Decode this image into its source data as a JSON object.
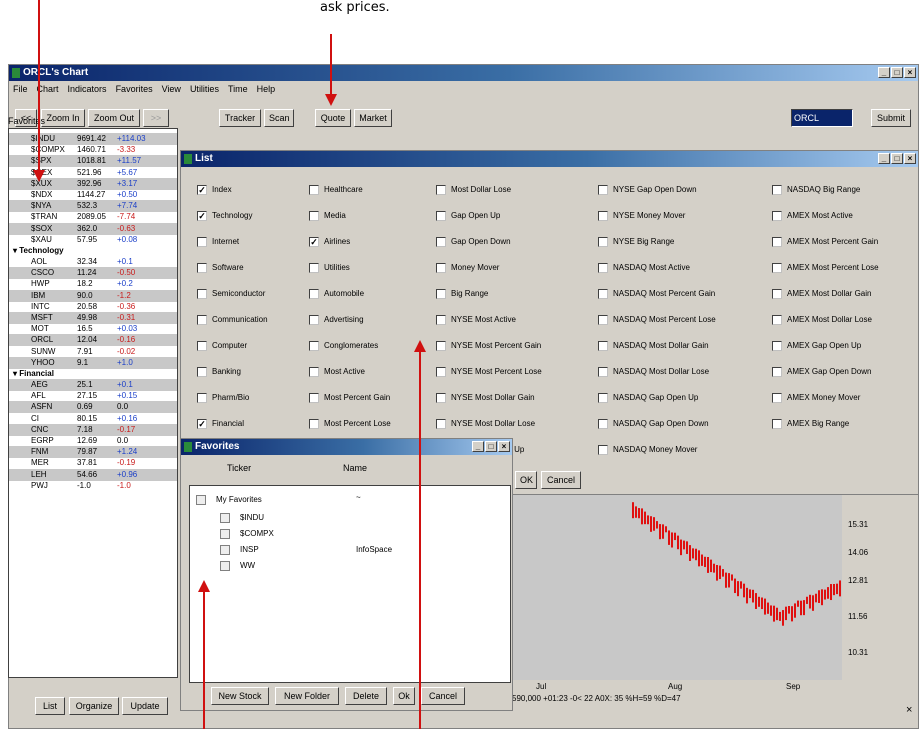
{
  "caption": "ask prices.",
  "main_window": {
    "title": "ORCL's Chart",
    "menu": [
      "File",
      "Chart",
      "Indicators",
      "Favorites",
      "View",
      "Utilities",
      "Time",
      "Help"
    ],
    "toolbar": {
      "back_label": "<<",
      "zoom_in_label": "Zoom In",
      "zoom_out_label": "Zoom Out",
      "forward_label": ">>",
      "tracker_label": "Tracker",
      "scan_label": "Scan",
      "quote_label": "Quote",
      "market_label": "Market",
      "symbol_value": "ORCL",
      "submit_label": "Submit"
    },
    "favorites_label": "Favorites",
    "bottom_buttons": {
      "list": "List",
      "organize": "Organize",
      "update": "Update"
    }
  },
  "favorites_tree": {
    "index_rows": [
      {
        "sym": "$INDU",
        "val": "9691.42",
        "chg": "+114.03",
        "dir": "pos",
        "hl": true
      },
      {
        "sym": "$COMPX",
        "val": "1460.71",
        "chg": "-3.33",
        "dir": "neg",
        "hl": false
      },
      {
        "sym": "$SPX",
        "val": "1018.81",
        "chg": "+11.57",
        "dir": "pos",
        "hl": true
      },
      {
        "sym": "$OEX",
        "val": "521.96",
        "chg": "+5.67",
        "dir": "pos",
        "hl": false
      },
      {
        "sym": "$XUX",
        "val": "392.96",
        "chg": "+3.17",
        "dir": "pos",
        "hl": true
      },
      {
        "sym": "$NDX",
        "val": "1144.27",
        "chg": "+0.50",
        "dir": "pos",
        "hl": false
      },
      {
        "sym": "$NYA",
        "val": "532.3",
        "chg": "+7.74",
        "dir": "pos",
        "hl": true
      },
      {
        "sym": "$TRAN",
        "val": "2089.05",
        "chg": "-7.74",
        "dir": "neg",
        "hl": false
      },
      {
        "sym": "$SOX",
        "val": "362.0",
        "chg": "-0.63",
        "dir": "neg",
        "hl": true
      },
      {
        "sym": "$XAU",
        "val": "57.95",
        "chg": "+0.08",
        "dir": "pos",
        "hl": false
      }
    ],
    "tech_group": "Technology",
    "tech_rows": [
      {
        "sym": "AOL",
        "val": "32.34",
        "chg": "+0.1",
        "dir": "pos",
        "hl": false
      },
      {
        "sym": "CSCO",
        "val": "11.24",
        "chg": "-0.50",
        "dir": "neg",
        "hl": true
      },
      {
        "sym": "HWP",
        "val": "18.2",
        "chg": "+0.2",
        "dir": "pos",
        "hl": false
      },
      {
        "sym": "IBM",
        "val": "90.0",
        "chg": "-1.2",
        "dir": "neg",
        "hl": true
      },
      {
        "sym": "INTC",
        "val": "20.58",
        "chg": "-0.36",
        "dir": "neg",
        "hl": false
      },
      {
        "sym": "MSFT",
        "val": "49.98",
        "chg": "-0.31",
        "dir": "neg",
        "hl": true
      },
      {
        "sym": "MOT",
        "val": "16.5",
        "chg": "+0.03",
        "dir": "pos",
        "hl": false
      },
      {
        "sym": "ORCL",
        "val": "12.04",
        "chg": "-0.16",
        "dir": "neg",
        "hl": true
      },
      {
        "sym": "SUNW",
        "val": "7.91",
        "chg": "-0.02",
        "dir": "neg",
        "hl": false
      },
      {
        "sym": "YHOO",
        "val": "9.1",
        "chg": "+1.0",
        "dir": "pos",
        "hl": true
      }
    ],
    "fin_group": "Financial",
    "fin_rows": [
      {
        "sym": "AEG",
        "val": "25.1",
        "chg": "+0.1",
        "dir": "pos",
        "hl": true
      },
      {
        "sym": "AFL",
        "val": "27.15",
        "chg": "+0.15",
        "dir": "pos",
        "hl": false
      },
      {
        "sym": "ASFN",
        "val": "0.69",
        "chg": "0.0",
        "dir": "zero",
        "hl": true
      },
      {
        "sym": "CI",
        "val": "80.15",
        "chg": "+0.16",
        "dir": "pos",
        "hl": false
      },
      {
        "sym": "CNC",
        "val": "7.18",
        "chg": "-0.17",
        "dir": "neg",
        "hl": true
      },
      {
        "sym": "EGRP",
        "val": "12.69",
        "chg": "0.0",
        "dir": "zero",
        "hl": false
      },
      {
        "sym": "FNM",
        "val": "79.87",
        "chg": "+1.24",
        "dir": "pos",
        "hl": true
      },
      {
        "sym": "MER",
        "val": "37.81",
        "chg": "-0.19",
        "dir": "neg",
        "hl": false
      },
      {
        "sym": "LEH",
        "val": "54.66",
        "chg": "+0.96",
        "dir": "pos",
        "hl": true
      },
      {
        "sym": "PWJ",
        "val": "-1.0",
        "chg": "-1.0",
        "dir": "neg",
        "hl": false
      }
    ]
  },
  "list_dialog": {
    "title": "List",
    "columns": [
      [
        {
          "label": "Index",
          "checked": true
        },
        {
          "label": "Technology",
          "checked": true
        },
        {
          "label": "Internet",
          "checked": false
        },
        {
          "label": "Software",
          "checked": false
        },
        {
          "label": "Semiconductor",
          "checked": false
        },
        {
          "label": "Communication",
          "checked": false
        },
        {
          "label": "Computer",
          "checked": false
        },
        {
          "label": "Banking",
          "checked": false
        },
        {
          "label": "Pharm/Bio",
          "checked": false
        },
        {
          "label": "Financial",
          "checked": true
        }
      ],
      [
        {
          "label": "Healthcare",
          "checked": false
        },
        {
          "label": "Media",
          "checked": false
        },
        {
          "label": "Airlines",
          "checked": true
        },
        {
          "label": "Utilities",
          "checked": false
        },
        {
          "label": "Automobile",
          "checked": false
        },
        {
          "label": "Advertising",
          "checked": false
        },
        {
          "label": "Conglomerates",
          "checked": false
        },
        {
          "label": "Most Active",
          "checked": false
        },
        {
          "label": "Most Percent Gain",
          "checked": false
        },
        {
          "label": "Most Percent Lose",
          "checked": false
        }
      ],
      [
        {
          "label": "Most Dollar Lose",
          "checked": false
        },
        {
          "label": "Gap Open Up",
          "checked": false
        },
        {
          "label": "Gap Open Down",
          "checked": false
        },
        {
          "label": "Money Mover",
          "checked": false
        },
        {
          "label": "Big Range",
          "checked": false
        },
        {
          "label": "NYSE Most Active",
          "checked": false
        },
        {
          "label": "NYSE Most Percent Gain",
          "checked": false
        },
        {
          "label": "NYSE Most Percent Lose",
          "checked": false
        },
        {
          "label": "NYSE Most Dollar Gain",
          "checked": false
        },
        {
          "label": "NYSE Most Dollar Lose",
          "checked": false
        },
        {
          "label": "NYSE Gap Open Up",
          "checked": false
        }
      ],
      [
        {
          "label": "NYSE Gap Open Down",
          "checked": false
        },
        {
          "label": "NYSE Money Mover",
          "checked": false
        },
        {
          "label": "NYSE Big Range",
          "checked": false
        },
        {
          "label": "NASDAQ Most Active",
          "checked": false
        },
        {
          "label": "NASDAQ Most Percent Gain",
          "checked": false
        },
        {
          "label": "NASDAQ Most Percent Lose",
          "checked": false
        },
        {
          "label": "NASDAQ Most Dollar Gain",
          "checked": false
        },
        {
          "label": "NASDAQ Most Dollar Lose",
          "checked": false
        },
        {
          "label": "NASDAQ Gap Open Up",
          "checked": false
        },
        {
          "label": "NASDAQ Gap Open Down",
          "checked": false
        },
        {
          "label": "NASDAQ Money Mover",
          "checked": false
        }
      ],
      [
        {
          "label": "NASDAQ Big Range",
          "checked": false
        },
        {
          "label": "AMEX Most Active",
          "checked": false
        },
        {
          "label": "AMEX Most Percent Gain",
          "checked": false
        },
        {
          "label": "AMEX Most Percent Lose",
          "checked": false
        },
        {
          "label": "AMEX Most Dollar Gain",
          "checked": false
        },
        {
          "label": "AMEX Most Dollar Lose",
          "checked": false
        },
        {
          "label": "AMEX Gap Open Up",
          "checked": false
        },
        {
          "label": "AMEX Gap Open Down",
          "checked": false
        },
        {
          "label": "AMEX Money Mover",
          "checked": false
        },
        {
          "label": "AMEX Big Range",
          "checked": false
        }
      ]
    ],
    "partial_text": "pen Up",
    "ok_label": "OK",
    "cancel_label": "Cancel"
  },
  "chart": {
    "y_labels": [
      "15.31",
      "14.06",
      "12.81",
      "11.56",
      "10.31"
    ],
    "x_labels": [
      "Jul",
      "Aug",
      "Sep"
    ],
    "status_text": "590,000 +01:23 -0< 22 A0X: 35 %H=59 %D=47"
  },
  "favorites_dialog": {
    "title": "Favorites",
    "col_ticker": "Ticker",
    "col_name": "Name",
    "root": "My Favorites",
    "root_name": "~",
    "items": [
      {
        "ticker": "$INDU",
        "name": ""
      },
      {
        "ticker": "$COMPX",
        "name": ""
      },
      {
        "ticker": "INSP",
        "name": "InfoSpace"
      },
      {
        "ticker": "WW",
        "name": ""
      }
    ],
    "buttons": {
      "new_stock": "New Stock",
      "new_folder": "New Folder",
      "delete": "Delete",
      "ok": "Ok",
      "cancel": "Cancel"
    }
  }
}
